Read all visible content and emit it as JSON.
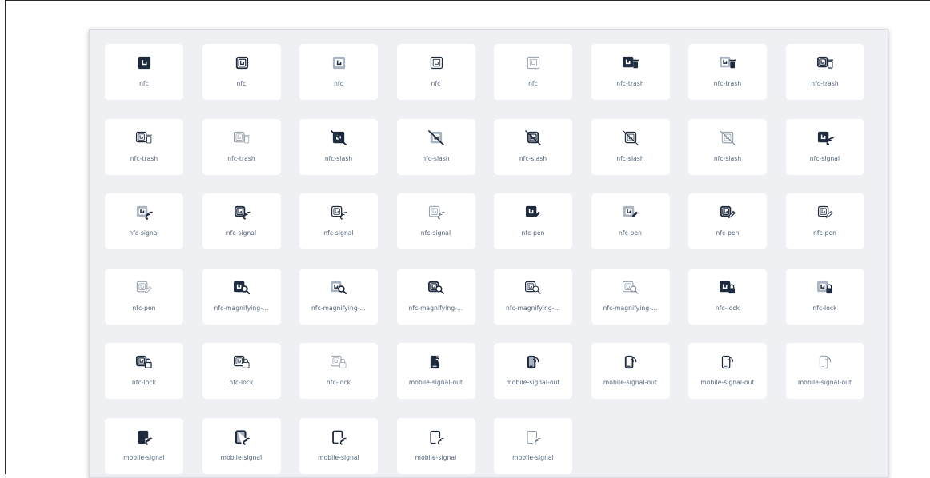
{
  "icons": [
    {
      "label": "nfc",
      "icon": "nfc-icon",
      "style": "solid"
    },
    {
      "label": "nfc",
      "icon": "nfc-icon",
      "style": "regular"
    },
    {
      "label": "nfc",
      "icon": "nfc-icon",
      "style": "duotone"
    },
    {
      "label": "nfc",
      "icon": "nfc-icon",
      "style": "light"
    },
    {
      "label": "nfc",
      "icon": "nfc-icon",
      "style": "thin"
    },
    {
      "label": "nfc-trash",
      "icon": "nfc-trash-icon",
      "style": "solid"
    },
    {
      "label": "nfc-trash",
      "icon": "nfc-trash-icon",
      "style": "duotone"
    },
    {
      "label": "nfc-trash",
      "icon": "nfc-trash-icon",
      "style": "regular"
    },
    {
      "label": "nfc-trash",
      "icon": "nfc-trash-icon",
      "style": "light"
    },
    {
      "label": "nfc-trash",
      "icon": "nfc-trash-icon",
      "style": "thin"
    },
    {
      "label": "nfc-slash",
      "icon": "nfc-slash-icon",
      "style": "solid"
    },
    {
      "label": "nfc-slash",
      "icon": "nfc-slash-icon",
      "style": "duotone"
    },
    {
      "label": "nfc-slash",
      "icon": "nfc-slash-icon",
      "style": "regular"
    },
    {
      "label": "nfc-slash",
      "icon": "nfc-slash-icon",
      "style": "light"
    },
    {
      "label": "nfc-slash",
      "icon": "nfc-slash-icon",
      "style": "thin"
    },
    {
      "label": "nfc-signal",
      "icon": "nfc-signal-icon",
      "style": "solid"
    },
    {
      "label": "nfc-signal",
      "icon": "nfc-signal-icon",
      "style": "duotone"
    },
    {
      "label": "nfc-signal",
      "icon": "nfc-signal-icon",
      "style": "regular"
    },
    {
      "label": "nfc-signal",
      "icon": "nfc-signal-icon",
      "style": "light"
    },
    {
      "label": "nfc-signal",
      "icon": "nfc-signal-icon",
      "style": "thin"
    },
    {
      "label": "nfc-pen",
      "icon": "nfc-pen-icon",
      "style": "solid"
    },
    {
      "label": "nfc-pen",
      "icon": "nfc-pen-icon",
      "style": "duotone"
    },
    {
      "label": "nfc-pen",
      "icon": "nfc-pen-icon",
      "style": "regular"
    },
    {
      "label": "nfc-pen",
      "icon": "nfc-pen-icon",
      "style": "light"
    },
    {
      "label": "nfc-pen",
      "icon": "nfc-pen-icon",
      "style": "thin"
    },
    {
      "label": "nfc-magnifying-...",
      "icon": "nfc-magnifying-glass-icon",
      "style": "solid"
    },
    {
      "label": "nfc-magnifying-...",
      "icon": "nfc-magnifying-glass-icon",
      "style": "duotone"
    },
    {
      "label": "nfc-magnifying-...",
      "icon": "nfc-magnifying-glass-icon",
      "style": "regular"
    },
    {
      "label": "nfc-magnifying-...",
      "icon": "nfc-magnifying-glass-icon",
      "style": "light"
    },
    {
      "label": "nfc-magnifying-...",
      "icon": "nfc-magnifying-glass-icon",
      "style": "thin"
    },
    {
      "label": "nfc-lock",
      "icon": "nfc-lock-icon",
      "style": "solid"
    },
    {
      "label": "nfc-lock",
      "icon": "nfc-lock-icon",
      "style": "duotone"
    },
    {
      "label": "nfc-lock",
      "icon": "nfc-lock-icon",
      "style": "regular"
    },
    {
      "label": "nfc-lock",
      "icon": "nfc-lock-icon",
      "style": "light"
    },
    {
      "label": "nfc-lock",
      "icon": "nfc-lock-icon",
      "style": "thin"
    },
    {
      "label": "mobile-signal-out",
      "icon": "mobile-signal-out-icon",
      "style": "solid"
    },
    {
      "label": "mobile-signal-out",
      "icon": "mobile-signal-out-icon",
      "style": "duotone"
    },
    {
      "label": "mobile-signal-out",
      "icon": "mobile-signal-out-icon",
      "style": "regular"
    },
    {
      "label": "mobile-signal-out",
      "icon": "mobile-signal-out-icon",
      "style": "light"
    },
    {
      "label": "mobile-signal-out",
      "icon": "mobile-signal-out-icon",
      "style": "thin"
    },
    {
      "label": "mobile-signal",
      "icon": "mobile-signal-icon",
      "style": "solid"
    },
    {
      "label": "mobile-signal",
      "icon": "mobile-signal-icon",
      "style": "duotone"
    },
    {
      "label": "mobile-signal",
      "icon": "mobile-signal-icon",
      "style": "regular"
    },
    {
      "label": "mobile-signal",
      "icon": "mobile-signal-icon",
      "style": "light"
    },
    {
      "label": "mobile-signal",
      "icon": "mobile-signal-icon",
      "style": "thin"
    }
  ],
  "colors": {
    "icon_dark": "#1e2b3e",
    "icon_light": "#a9b3c1",
    "label": "#50627a",
    "panel_bg": "#eef0f3",
    "card_bg": "#ffffff"
  }
}
